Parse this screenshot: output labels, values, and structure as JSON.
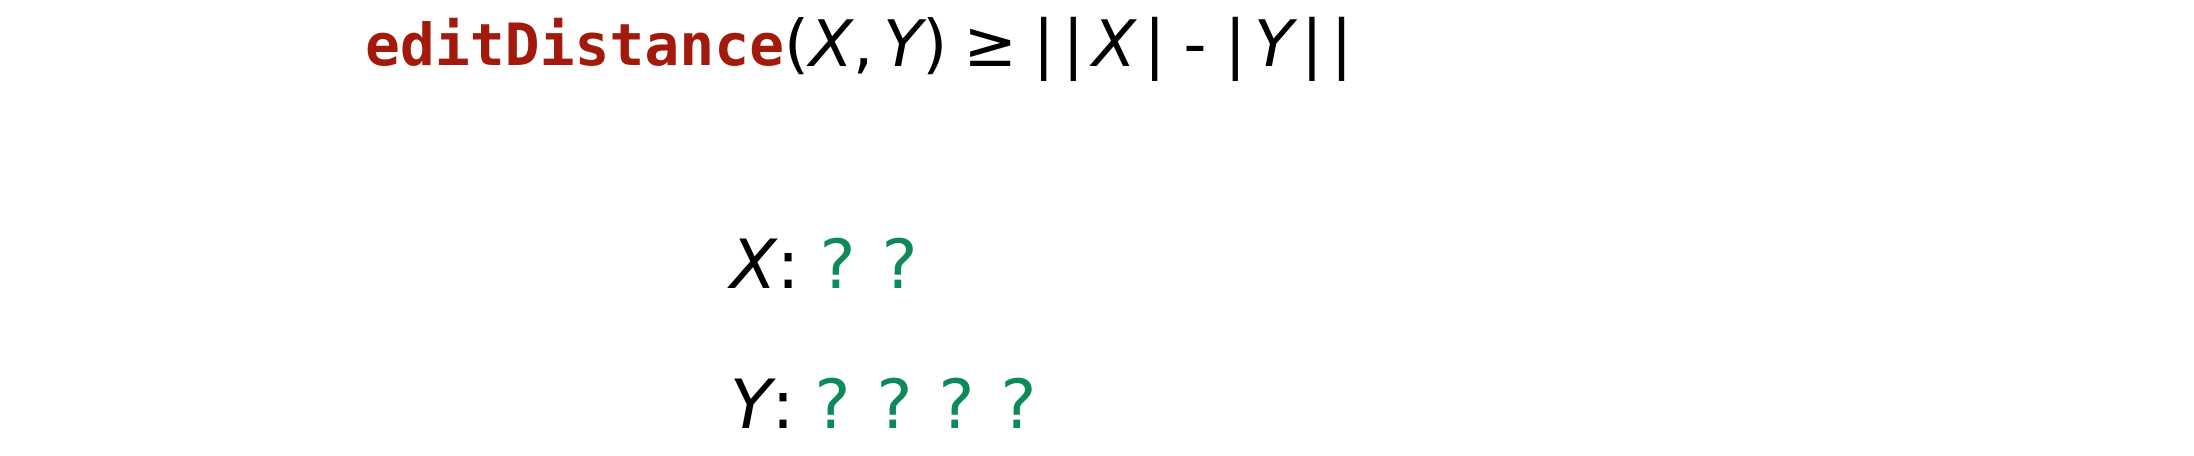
{
  "formula": {
    "function_name": "editDistance",
    "open_paren": "(",
    "arg1": "X",
    "comma": ",",
    "arg2": "Y",
    "close_paren": ")",
    "relation": "≥",
    "outer_bar_left": "|",
    "inner_bar1": "|",
    "abs_x": "X",
    "inner_bar2": "|",
    "minus": "-",
    "inner_bar3": "|",
    "abs_y": "Y",
    "inner_bar4": "|",
    "outer_bar_right": "|"
  },
  "sequences": {
    "x": {
      "label": "X",
      "colon": ":",
      "symbols": [
        "?",
        "?"
      ]
    },
    "y": {
      "label": "Y",
      "colon": ":",
      "symbols": [
        "?",
        "?",
        "?",
        "?"
      ]
    }
  },
  "colors": {
    "function_name": "#a31a0c",
    "unknown_symbol": "#0e8a5a",
    "text": "#000000"
  }
}
